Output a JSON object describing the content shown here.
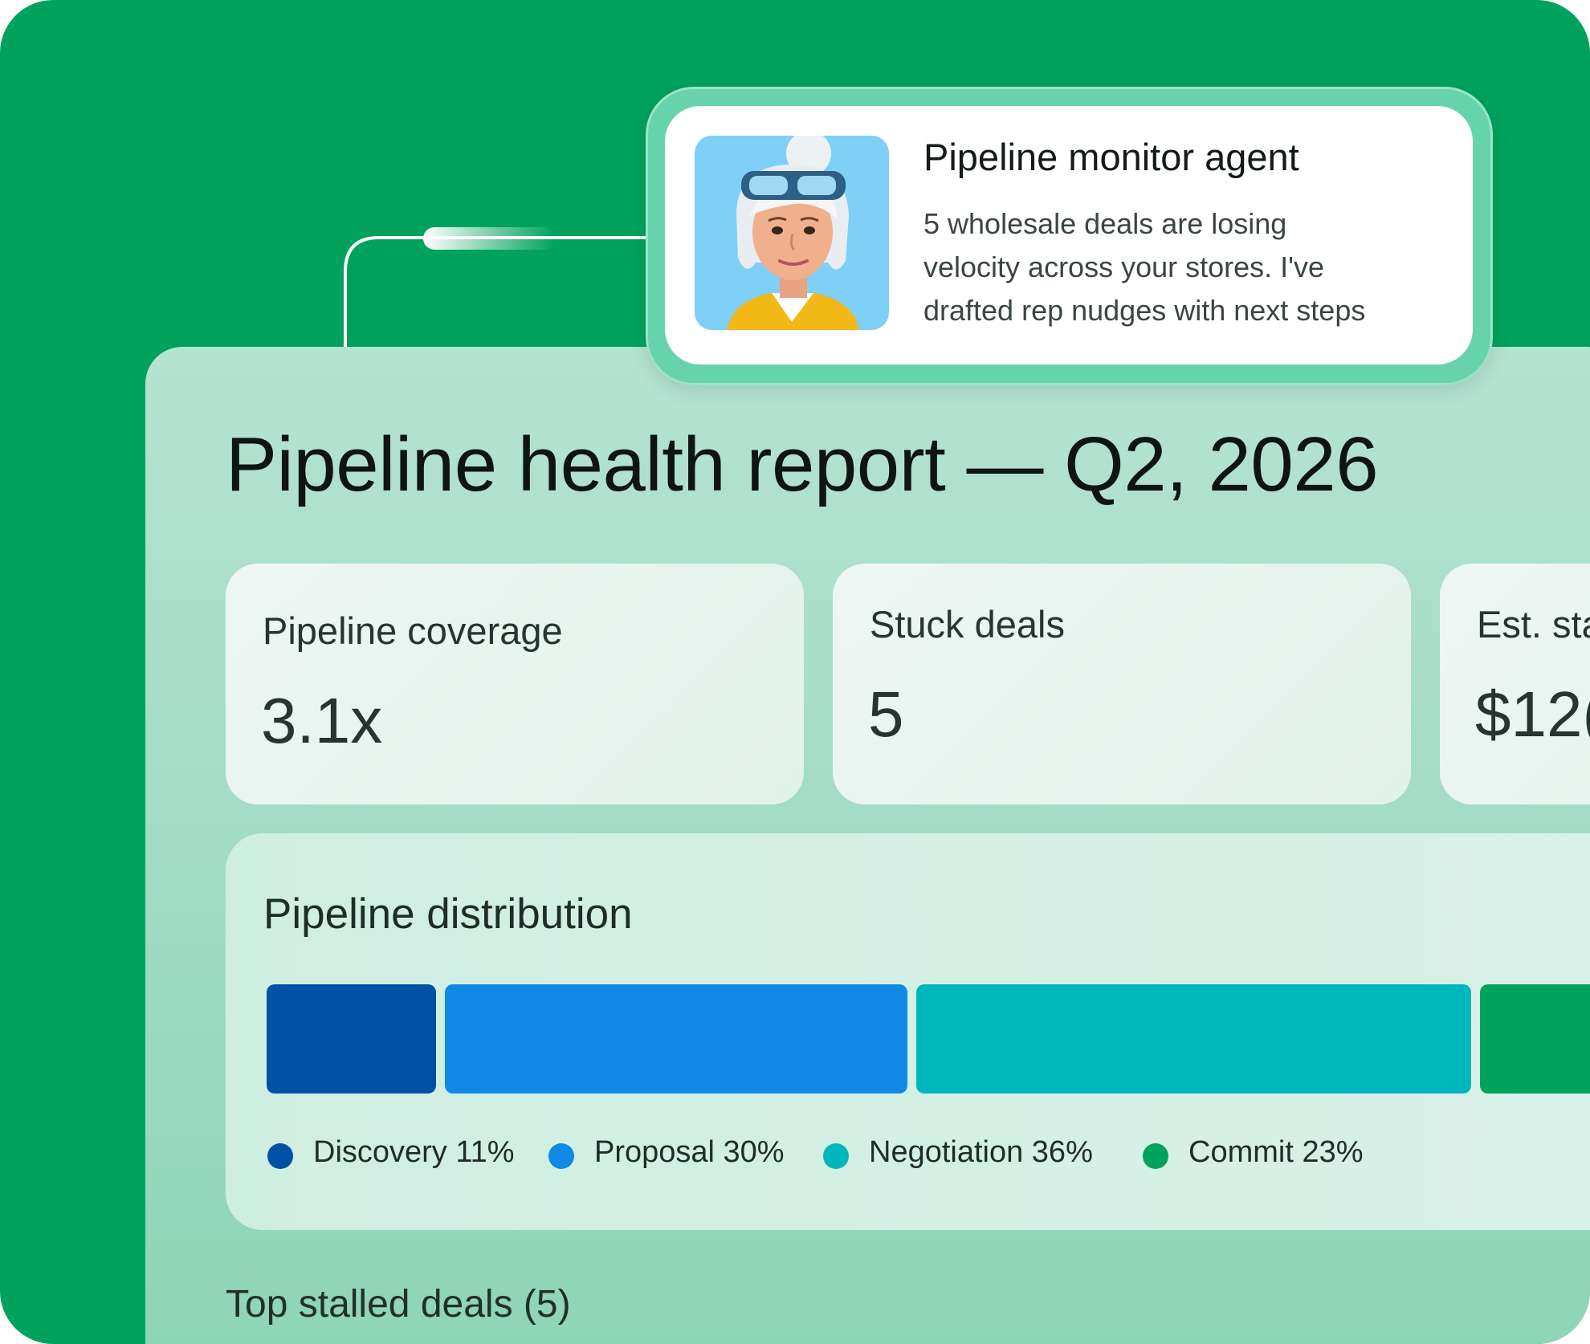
{
  "agent": {
    "title": "Pipeline monitor agent",
    "message_lines": [
      "5 wholesale deals are losing",
      "velocity across your stores. I've",
      "drafted rep nudges with next steps"
    ],
    "avatar_icon": "agent-avatar-character"
  },
  "report": {
    "title": "Pipeline health report — Q2, 2026",
    "metrics": [
      {
        "label": "Pipeline coverage",
        "value": "3.1x"
      },
      {
        "label": "Stuck deals",
        "value": "5"
      },
      {
        "label": "Est. sta",
        "value": "$12("
      }
    ],
    "distribution": {
      "title": "Pipeline distribution",
      "legend": [
        {
          "label": "Discovery 11%",
          "color": "#0050a5"
        },
        {
          "label": "Proposal 30%",
          "color": "#118ae6"
        },
        {
          "label": "Negotiation 36%",
          "color": "#00b6bd"
        },
        {
          "label": "Commit 23%",
          "color": "#00a25e"
        }
      ]
    },
    "stalled_title": "Top stalled deals (5)"
  },
  "colors": {
    "background": "#00a25e",
    "agent_frame": "#67d3ad"
  },
  "chart_data": {
    "type": "bar",
    "title": "Pipeline distribution",
    "orientation": "stacked-horizontal",
    "categories": [
      "Discovery",
      "Proposal",
      "Negotiation",
      "Commit"
    ],
    "values": [
      11,
      30,
      36,
      23
    ],
    "unit": "%",
    "colors": [
      "#0050a5",
      "#118ae6",
      "#00b6bd",
      "#00a25e"
    ],
    "legend_placement": "bottom"
  }
}
